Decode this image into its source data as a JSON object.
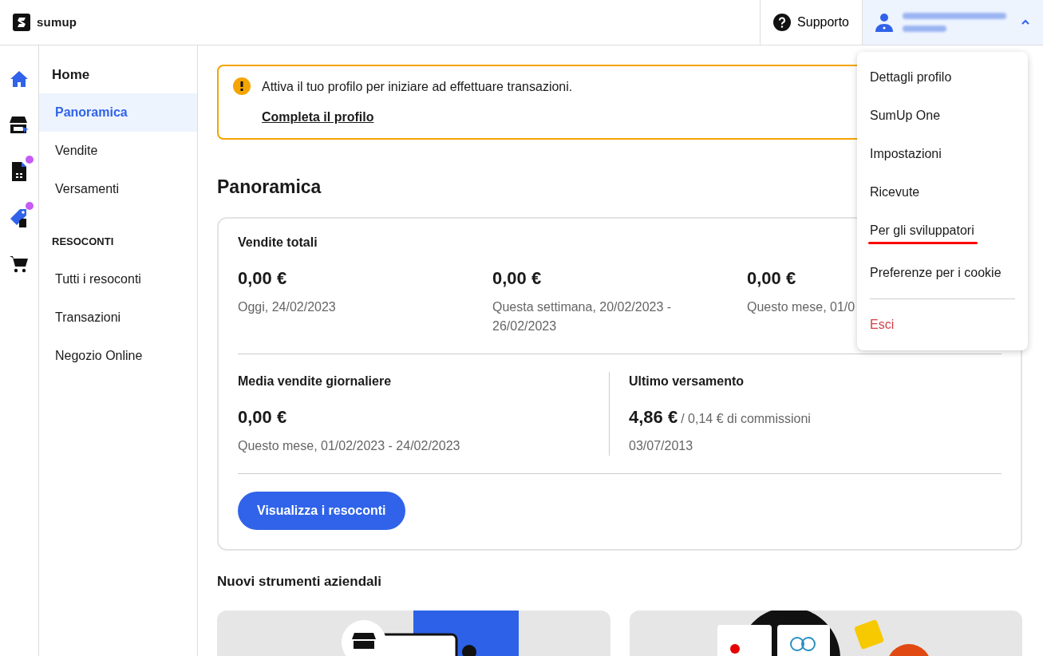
{
  "header": {
    "logo_text": "sumup",
    "support": "Supporto",
    "user_menu_expanded": true
  },
  "rail": [
    {
      "kind": "home",
      "selected": true,
      "notification": false
    },
    {
      "kind": "store",
      "selected": false,
      "notification": false
    },
    {
      "kind": "invoice",
      "selected": false,
      "notification": true
    },
    {
      "kind": "tag",
      "selected": false,
      "notification": true
    },
    {
      "kind": "cart",
      "selected": false,
      "notification": false
    }
  ],
  "sidebar": {
    "title": "Home",
    "items": [
      {
        "label": "Panoramica",
        "selected": true
      },
      {
        "label": "Vendite",
        "selected": false
      },
      {
        "label": "Versamenti",
        "selected": false
      }
    ],
    "section": "RESOCONTI",
    "section_items": [
      {
        "label": "Tutti i resoconti",
        "selected": false
      },
      {
        "label": "Transazioni",
        "selected": false
      },
      {
        "label": "Negozio Online",
        "selected": false
      }
    ]
  },
  "alert": {
    "text": "Attiva il tuo profilo per iniziare ad effettuare transazioni.",
    "link": "Completa il profilo"
  },
  "page_title": "Panoramica",
  "sales_card": {
    "title": "Vendite totali",
    "stats": [
      {
        "amount": "0,00 €",
        "caption": "Oggi, 24/02/2023"
      },
      {
        "amount": "0,00 €",
        "caption": "Questa settimana, 20/02/2023 - 26/02/2023"
      },
      {
        "amount": "0,00 €",
        "caption": "Questo mese, 01/0"
      }
    ],
    "daily": {
      "title": "Media vendite giornaliere",
      "amount": "0,00 €",
      "caption": "Questo mese, 01/02/2023 - 24/02/2023"
    },
    "payout": {
      "title": "Ultimo versamento",
      "amount": "4,86 €",
      "fee": "/ 0,14 € di commissioni",
      "caption": "03/07/2013"
    },
    "button": "Visualizza i resoconti"
  },
  "tools_title": "Nuovi strumenti aziendali",
  "menu": [
    {
      "label": "Dettagli profilo",
      "kind": "normal",
      "underlined": false
    },
    {
      "label": "SumUp One",
      "kind": "normal",
      "underlined": false
    },
    {
      "label": "Impostazioni",
      "kind": "normal",
      "underlined": false
    },
    {
      "label": "Ricevute",
      "kind": "normal",
      "underlined": false
    },
    {
      "label": "Per gli sviluppatori",
      "kind": "normal",
      "underlined": true
    },
    {
      "label": "Preferenze per i cookie",
      "kind": "normal",
      "underlined": false
    },
    {
      "label": "Esci",
      "kind": "danger",
      "underlined": false
    }
  ]
}
